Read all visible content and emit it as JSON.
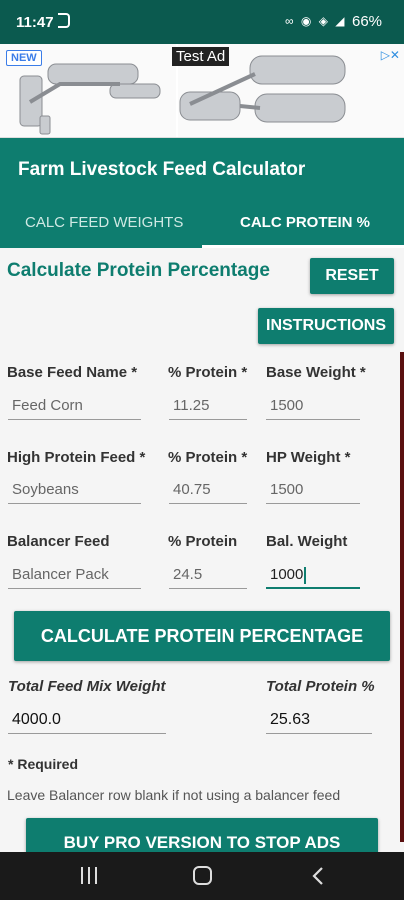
{
  "status_bar": {
    "time": "11:47",
    "battery": "66%"
  },
  "ad": {
    "badge": "NEW",
    "label": "Test Ad"
  },
  "app": {
    "title": "Farm Livestock Feed Calculator",
    "tabs": [
      {
        "label": "CALC FEED WEIGHTS"
      },
      {
        "label": "CALC PROTEIN %"
      }
    ],
    "active_tab": 1
  },
  "main": {
    "section_title": "Calculate Protein Percentage",
    "reset_label": "RESET",
    "instructions_label": "INSTRUCTIONS",
    "rows": [
      {
        "name_label": "Base Feed Name *",
        "pct_label": "% Protein *",
        "weight_label": "Base Weight *",
        "name_value": "Feed Corn",
        "pct_value": "11.25",
        "weight_value": "1500"
      },
      {
        "name_label": "High Protein Feed *",
        "pct_label": "% Protein *",
        "weight_label": "HP Weight *",
        "name_value": "Soybeans",
        "pct_value": "40.75",
        "weight_value": "1500"
      },
      {
        "name_label": "Balancer Feed",
        "pct_label": "% Protein",
        "weight_label": "Bal. Weight",
        "name_value": "Balancer Pack",
        "pct_value": "24.5",
        "weight_value": "1000"
      }
    ],
    "calculate_label": "CALCULATE PROTEIN PERCENTAGE",
    "total_weight_label": "Total Feed Mix Weight",
    "total_protein_label": "Total Protein %",
    "total_weight_value": "4000.0",
    "total_protein_value": "25.63",
    "required_note": "* Required",
    "balancer_note": "Leave Balancer row blank if not using a balancer feed",
    "buy_label": "BUY PRO VERSION TO STOP ADS"
  },
  "colors": {
    "primary": "#0e7d6f",
    "status_bar": "#0b5a4f",
    "nav_bar": "#1a1a1a"
  }
}
